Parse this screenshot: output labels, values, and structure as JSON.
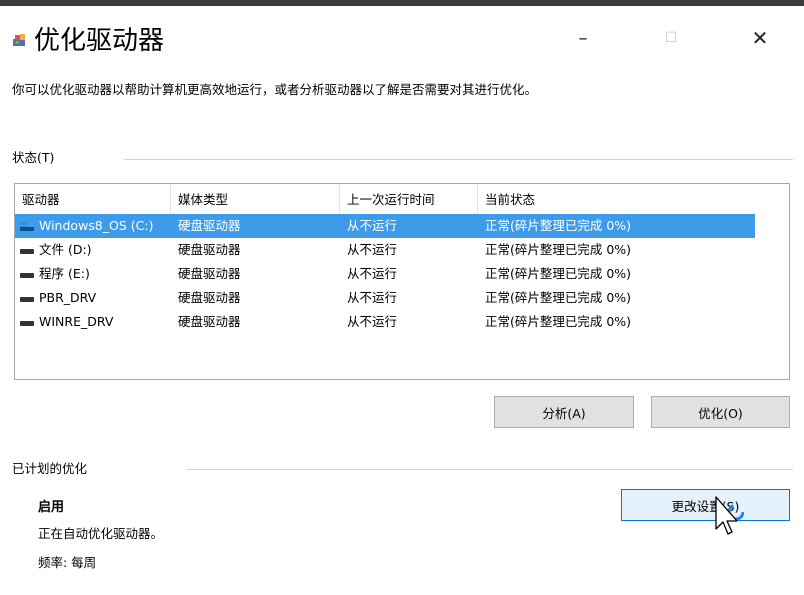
{
  "window": {
    "title": "优化驱动器",
    "minimize_glyph": "–",
    "maximize_glyph": "☐",
    "close_glyph": "✕"
  },
  "description": "你可以优化驱动器以帮助计算机更高效地运行，或者分析驱动器以了解是否需要对其进行优化。",
  "status_section": {
    "label": "状态(T)",
    "columns": [
      "驱动器",
      "媒体类型",
      "上一次运行时间",
      "当前状态"
    ],
    "rows": [
      {
        "drive": "Windows8_OS (C:)",
        "media": "硬盘驱动器",
        "last_run": "从不运行",
        "status": "正常(碎片整理已完成 0%)",
        "icon": "system-drive-icon",
        "selected": true
      },
      {
        "drive": "文件 (D:)",
        "media": "硬盘驱动器",
        "last_run": "从不运行",
        "status": "正常(碎片整理已完成 0%)",
        "icon": "hard-drive-icon",
        "selected": false
      },
      {
        "drive": "程序 (E:)",
        "media": "硬盘驱动器",
        "last_run": "从不运行",
        "status": "正常(碎片整理已完成 0%)",
        "icon": "hard-drive-icon",
        "selected": false
      },
      {
        "drive": "PBR_DRV",
        "media": "硬盘驱动器",
        "last_run": "从不运行",
        "status": "正常(碎片整理已完成 0%)",
        "icon": "hard-drive-icon",
        "selected": false
      },
      {
        "drive": "WINRE_DRV",
        "media": "硬盘驱动器",
        "last_run": "从不运行",
        "status": "正常(碎片整理已完成 0%)",
        "icon": "hard-drive-icon",
        "selected": false
      }
    ],
    "analyze_label": "分析(A)",
    "optimize_label": "优化(O)"
  },
  "schedule_section": {
    "label": "已计划的优化",
    "state": "启用",
    "text": "正在自动优化驱动器。",
    "frequency": "频率: 每周",
    "change_settings_label": "更改设置(S)"
  },
  "colors": {
    "selection": "#3d9be9",
    "focus_border": "#0078d7"
  }
}
